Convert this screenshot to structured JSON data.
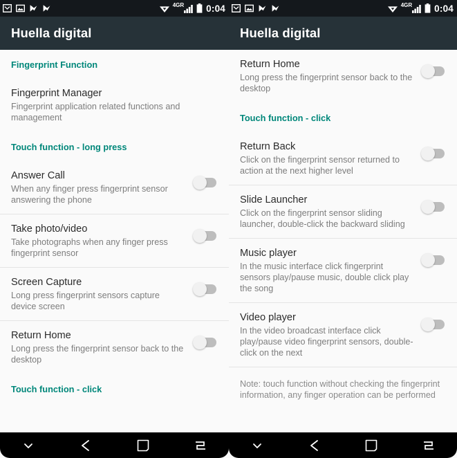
{
  "colors": {
    "statusbar_bg": "#14181c",
    "appbar_bg": "#263238",
    "accent_teal": "#00877a",
    "body_bg": "#fafafa",
    "title_text": "#2b2b2b",
    "sub_text": "#7d7d7d",
    "navbar_bg": "#000000",
    "switch_track": "#bdbdbd",
    "switch_thumb": "#f1f1f1"
  },
  "statusbar": {
    "time": "0:04",
    "network_label": "4GR",
    "left_icons": [
      "gmail-icon",
      "photos-icon",
      "checkmark-flag-icon",
      "checkmark-flag-icon"
    ],
    "right_icons": [
      "wifi-icon",
      "signal-bars-icon",
      "battery-icon"
    ]
  },
  "navbar": {
    "buttons": [
      {
        "name": "hide-keyboard-button",
        "icon": "chevron-down-icon"
      },
      {
        "name": "back-button",
        "icon": "arrow-left-icon"
      },
      {
        "name": "home-button",
        "icon": "square-icon"
      },
      {
        "name": "recent-apps-button",
        "icon": "switch-apps-icon"
      }
    ]
  },
  "left_screen": {
    "appbar": {
      "title": "Huella digital"
    },
    "items": [
      {
        "kind": "section",
        "name": "section-fingerprint-function",
        "label": "Fingerprint Function"
      },
      {
        "kind": "row",
        "name": "row-fingerprint-manager",
        "title": "Fingerprint Manager",
        "subtitle": "Fingerprint application related functions and management",
        "has_switch": false,
        "switch_state": "",
        "divider": false
      },
      {
        "kind": "section",
        "name": "section-touch-function-long-press",
        "label": "Touch function - long press"
      },
      {
        "kind": "row",
        "name": "row-answer-call",
        "title": "Answer Call",
        "subtitle": "When any finger press fingerprint sensor answering the phone",
        "has_switch": true,
        "switch_state": "off",
        "divider": true
      },
      {
        "kind": "row",
        "name": "row-take-photo-video",
        "title": "Take photo/video",
        "subtitle": "Take photographs when any finger press fingerprint sensor",
        "has_switch": true,
        "switch_state": "off",
        "divider": true
      },
      {
        "kind": "row",
        "name": "row-screen-capture",
        "title": "Screen Capture",
        "subtitle": "Long press fingerprint sensors capture device screen",
        "has_switch": true,
        "switch_state": "off",
        "divider": true
      },
      {
        "kind": "row",
        "name": "row-return-home",
        "title": "Return Home",
        "subtitle": "Long press the fingerprint sensor back to the desktop",
        "has_switch": true,
        "switch_state": "off",
        "divider": false
      },
      {
        "kind": "section",
        "name": "section-touch-function-click",
        "label": "Touch function - click"
      }
    ]
  },
  "right_screen": {
    "appbar": {
      "title": "Huella digital"
    },
    "items": [
      {
        "kind": "row",
        "name": "row-return-home",
        "title": "Return Home",
        "subtitle": "Long press the fingerprint sensor back to the desktop",
        "has_switch": true,
        "switch_state": "off",
        "divider": false
      },
      {
        "kind": "section",
        "name": "section-touch-function-click",
        "label": "Touch function - click"
      },
      {
        "kind": "row",
        "name": "row-return-back",
        "title": "Return Back",
        "subtitle": "Click on the fingerprint sensor returned to action at the next higher level",
        "has_switch": true,
        "switch_state": "off",
        "divider": true
      },
      {
        "kind": "row",
        "name": "row-slide-launcher",
        "title": "Slide Launcher",
        "subtitle": "Click on the fingerprint sensor sliding launcher, double-click the backward sliding",
        "has_switch": true,
        "switch_state": "off",
        "divider": true
      },
      {
        "kind": "row",
        "name": "row-music-player",
        "title": "Music player",
        "subtitle": "In the music interface click fingerprint sensors play/pause music, double click play the song",
        "has_switch": true,
        "switch_state": "off",
        "divider": true
      },
      {
        "kind": "row",
        "name": "row-video-player",
        "title": "Video player",
        "subtitle": "In the video broadcast interface click play/pause video fingerprint sensors, double-click on the next",
        "has_switch": true,
        "switch_state": "off",
        "divider": true
      },
      {
        "kind": "note",
        "name": "note-touch-function",
        "text": "Note: touch function without checking the fingerprint information, any finger operation can be performed"
      }
    ]
  }
}
